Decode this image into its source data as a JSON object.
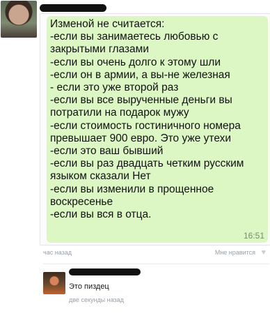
{
  "post": {
    "message_lines": [
      "Изменой не считается:",
      "-если вы занимаетесь любовью с",
      "закрытыми глазами",
      "-если вы очень долго к этому шли",
      "-если он в армии, а вы-не железная",
      "- если это уже второй раз",
      "-если вы все вырученные деньги вы",
      "потратили на подарок мужу",
      "-если стоимость гостиничного номера",
      "превышает 900 евро. Это уже утехи",
      "-если это ваш бывший",
      "-если вы раз двадцать четким русским",
      "языком сказали Нет",
      "-если вы изменили в прощенное",
      "воскресенье",
      "-если вы вся в отца."
    ],
    "message_time": "16:51",
    "posted_ago": "час назад",
    "like_label": "Мне нравится",
    "like_icon": "heart-icon"
  },
  "comment": {
    "text": "Это пиздец",
    "time": "две секунды назад"
  }
}
